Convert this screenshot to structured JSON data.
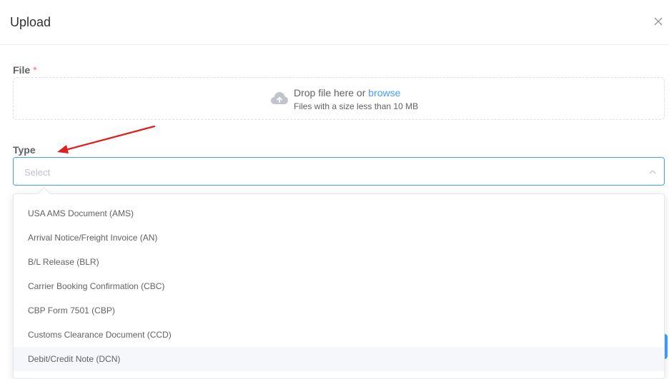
{
  "dialog": {
    "title": "Upload"
  },
  "file_field": {
    "label": "File",
    "required_mark": "*",
    "drop_text": "Drop file here or",
    "browse_text": "browse",
    "hint": "Files with a size less than 10 MB"
  },
  "type_field": {
    "label": "Type",
    "placeholder": "Select",
    "options": [
      "USA AMS Document (AMS)",
      "Arrival Notice/Freight Invoice (AN)",
      "B/L Release (BLR)",
      "Carrier Booking Confirmation (CBC)",
      "CBP Form 7501 (CBP)",
      "Customs Clearance Document (CCD)",
      "Debit/Credit Note (DCN)"
    ],
    "hovered_option": "Debit/Credit Note (DCN)"
  },
  "colors": {
    "accent": "#409eff",
    "required": "#f56c6c",
    "annotation_arrow": "#e02020"
  },
  "icons": {
    "close": "close-icon",
    "upload": "cloud-upload-icon",
    "select_arrow": "chevron-up-icon"
  }
}
